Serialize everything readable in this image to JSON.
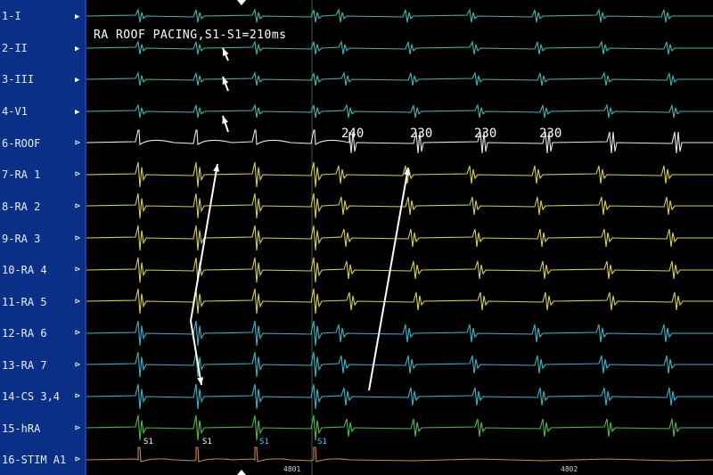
{
  "channels": [
    {
      "label": "1-I",
      "marker": "▶",
      "color": "#3fb5b0"
    },
    {
      "label": "2-II",
      "marker": "▶",
      "color": "#3fb5b0"
    },
    {
      "label": "3-III",
      "marker": "▶",
      "color": "#3fb5b0"
    },
    {
      "label": "4-V1",
      "marker": "▶",
      "color": "#3fb5b0"
    },
    {
      "label": "6-ROOF",
      "marker": "⊳",
      "color": "#e8e8e8"
    },
    {
      "label": "7-RA  1",
      "marker": "⊳",
      "color": "#d8cf48"
    },
    {
      "label": "8-RA  2",
      "marker": "⊳",
      "color": "#d8cf48"
    },
    {
      "label": "9-RA  3",
      "marker": "⊳",
      "color": "#d8cf48"
    },
    {
      "label": "10-RA  4",
      "marker": "⊳",
      "color": "#d8cf48"
    },
    {
      "label": "11-RA  5",
      "marker": "⊳",
      "color": "#d8cf48"
    },
    {
      "label": "12-RA  6",
      "marker": "⊳",
      "color": "#36b5c8"
    },
    {
      "label": "13-RA  7",
      "marker": "⊳",
      "color": "#36b5c8"
    },
    {
      "label": "14-CS  3,4",
      "marker": "⊳",
      "color": "#36b5c8"
    },
    {
      "label": "15-hRA",
      "marker": "⊳",
      "color": "#4fb84a"
    },
    {
      "label": "16-STIM  A1",
      "marker": "⊳",
      "color": "#c8884a"
    }
  ],
  "annotation": "RA ROOF PACING,S1-S1=210ms",
  "intervals": [
    "240",
    "230",
    "230",
    "230"
  ],
  "stim_labels": [
    "S1",
    "S1",
    "S1",
    "S1"
  ],
  "counters": [
    "4801",
    "4802"
  ]
}
